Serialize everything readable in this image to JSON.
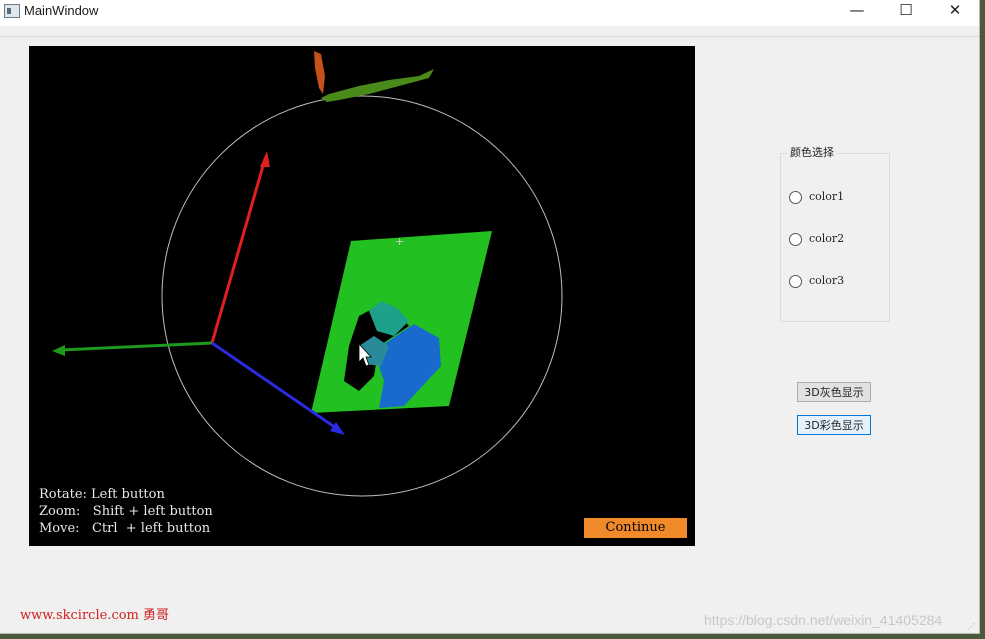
{
  "window": {
    "title": "MainWindow",
    "controls": {
      "minimize": "—",
      "maximize": "☐",
      "close": "✕"
    }
  },
  "viewer": {
    "help_lines": [
      "Rotate: Left button",
      "Zoom:   Shift + left button",
      "Move:   Ctrl  + left button"
    ],
    "continue_label": "Continue",
    "axis_colors": {
      "x": "#2a2ae0",
      "y": "#1f9a1f",
      "z": "#e02020"
    },
    "plane_color": "#22c020"
  },
  "color_group": {
    "title": "颜色选择",
    "options": [
      {
        "label": "color1",
        "selected": false
      },
      {
        "label": "color2",
        "selected": false
      },
      {
        "label": "color3",
        "selected": false
      }
    ]
  },
  "buttons": {
    "gray": "3D灰色显示",
    "color": "3D彩色显示"
  },
  "watermarks": {
    "left": "www.skcircle.com 勇哥",
    "right": "https://blog.csdn.net/weixin_41405284"
  }
}
